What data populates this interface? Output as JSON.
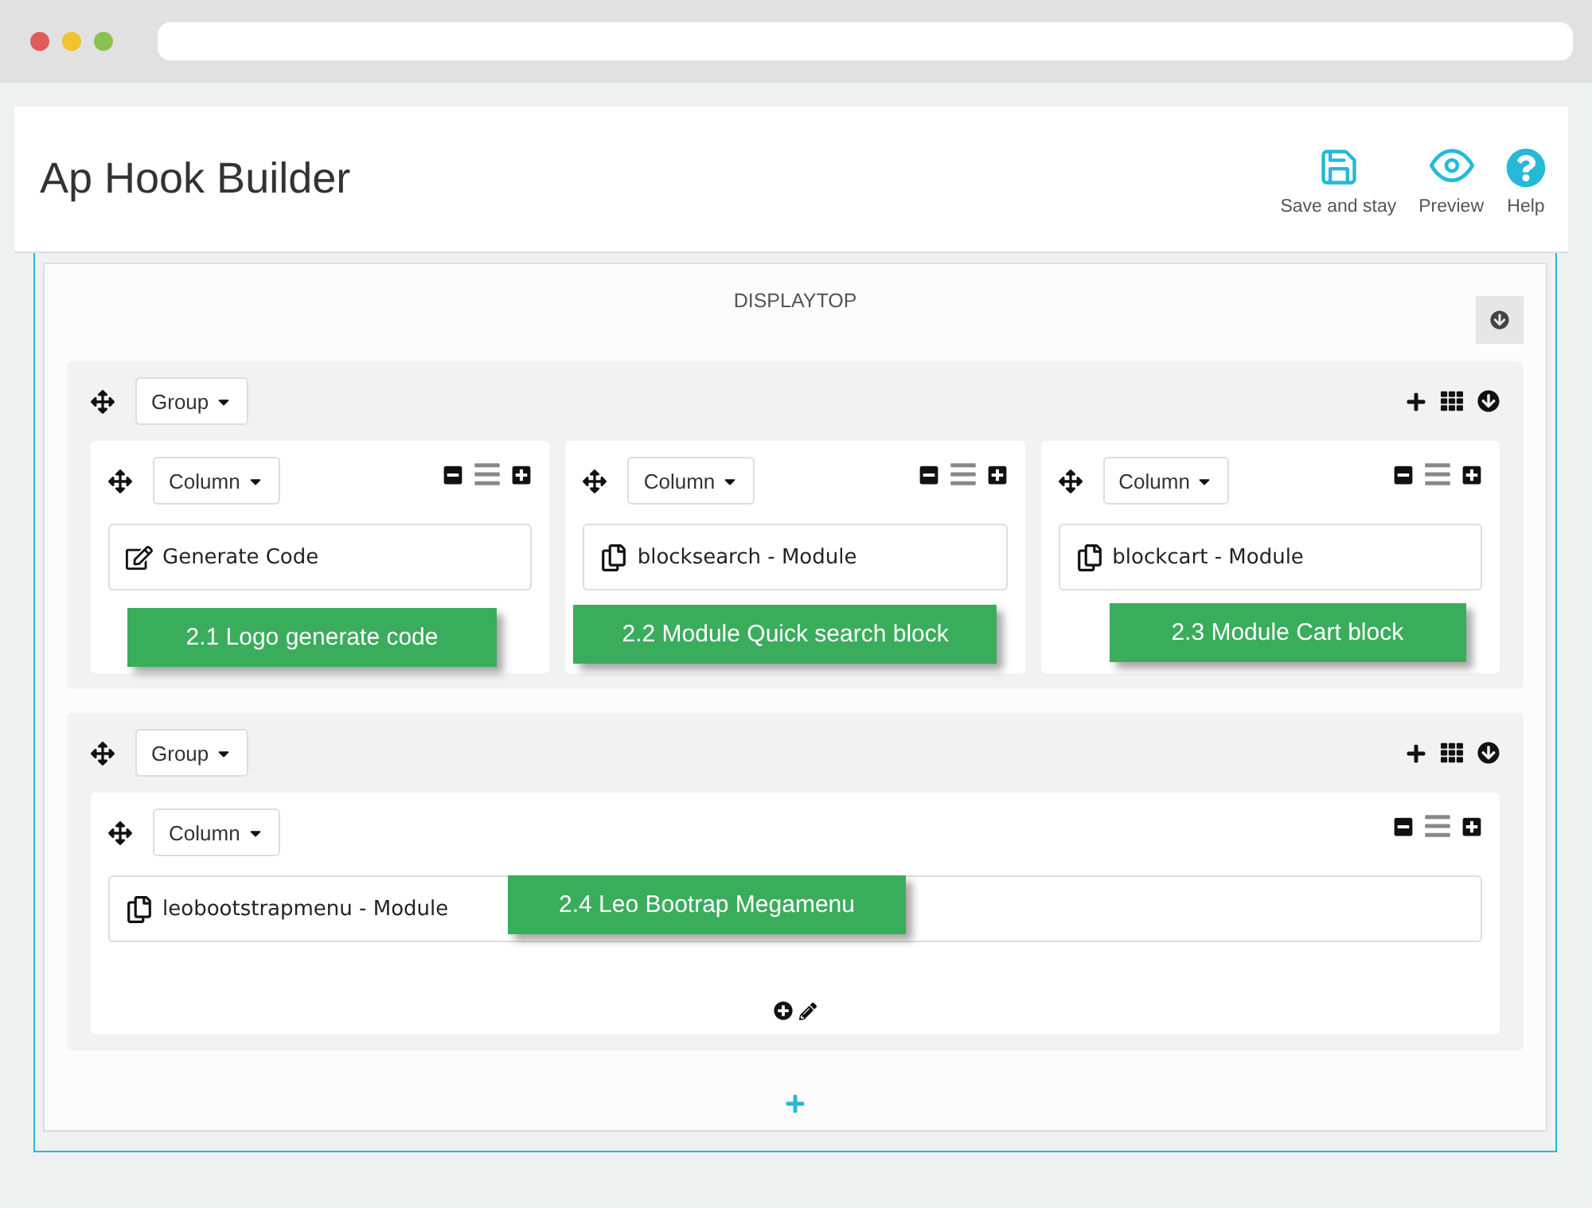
{
  "header": {
    "title": "Ap Hook Builder",
    "actions": [
      {
        "kind": "save",
        "label": "Save and stay"
      },
      {
        "kind": "preview",
        "label": "Preview"
      },
      {
        "kind": "help",
        "label": "Help"
      }
    ]
  },
  "hook": {
    "title": "DISPLAYTOP"
  },
  "groups": [
    {
      "label": "Group",
      "columns": [
        {
          "label": "Column",
          "module": {
            "kind": "code",
            "label": "Generate Code"
          },
          "callout": "2.1 Logo generate code"
        },
        {
          "label": "Column",
          "module": {
            "kind": "module",
            "label": "blocksearch - Module"
          },
          "callout": "2.2 Module Quick search block"
        },
        {
          "label": "Column",
          "module": {
            "kind": "module",
            "label": "blockcart - Module"
          },
          "callout": "2.3 Module Cart block"
        }
      ]
    },
    {
      "label": "Group",
      "columns": [
        {
          "label": "Column",
          "module": {
            "kind": "module",
            "label": "leobootstrapmenu - Module"
          },
          "callout": "2.4 Leo Bootrap Megamenu"
        }
      ]
    }
  ]
}
